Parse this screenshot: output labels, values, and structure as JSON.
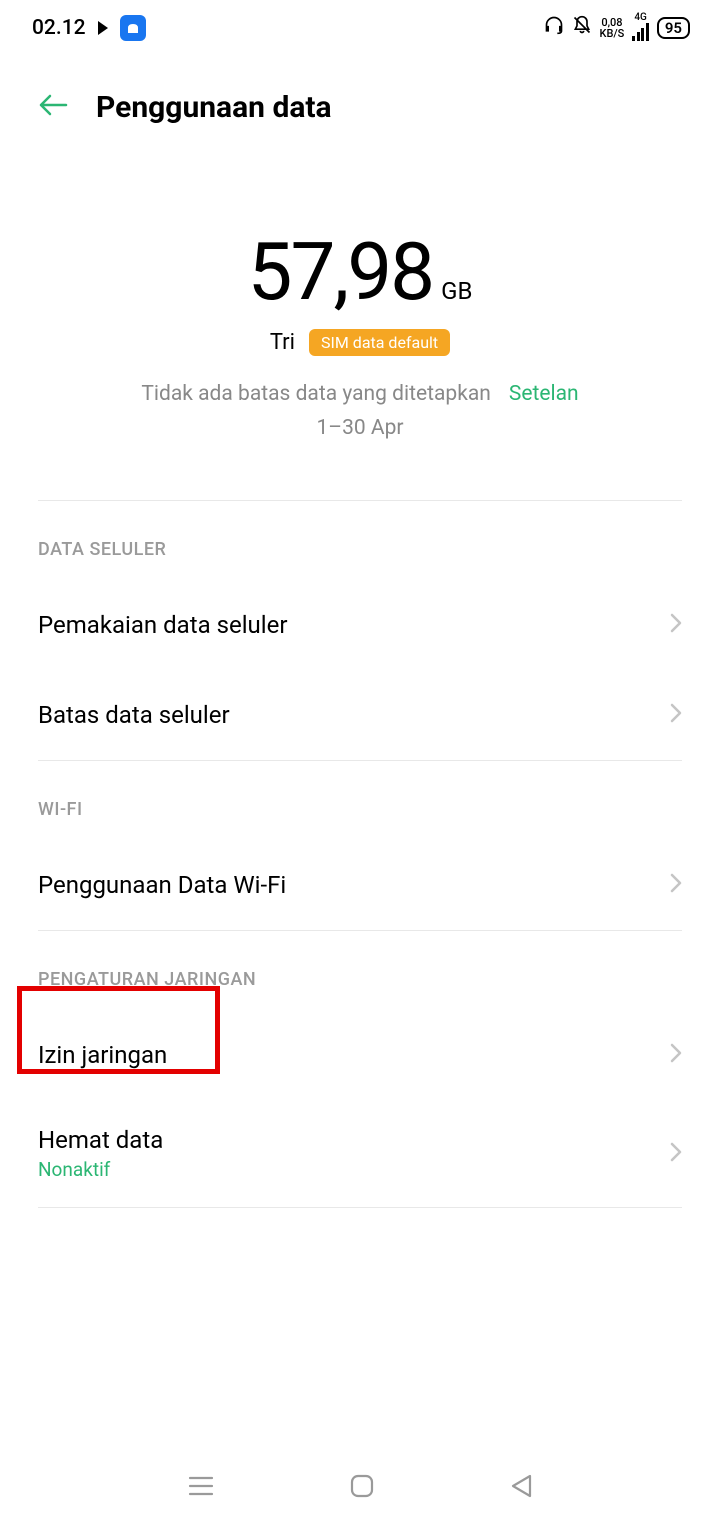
{
  "status": {
    "time": "02.12",
    "data_speed_value": "0,08",
    "data_speed_unit": "KB/S",
    "network_type": "4G",
    "battery": "95"
  },
  "header": {
    "title": "Penggunaan data"
  },
  "summary": {
    "value": "57,98",
    "unit": "GB",
    "carrier": "Tri",
    "sim_badge": "SIM data default",
    "limit_text": "Tidak ada batas data yang ditetapkan",
    "settings_link": "Setelan",
    "date_range": "1–30 Apr"
  },
  "sections": {
    "cellular": {
      "header": "DATA SELULER",
      "items": [
        {
          "title": "Pemakaian data seluler"
        },
        {
          "title": "Batas data seluler"
        }
      ]
    },
    "wifi": {
      "header": "WI-FI",
      "items": [
        {
          "title": "Penggunaan Data Wi-Fi"
        }
      ]
    },
    "network": {
      "header": "PENGATURAN JARINGAN",
      "items": [
        {
          "title": "Izin jaringan"
        },
        {
          "title": "Hemat data",
          "subtitle": "Nonaktif"
        }
      ]
    }
  }
}
